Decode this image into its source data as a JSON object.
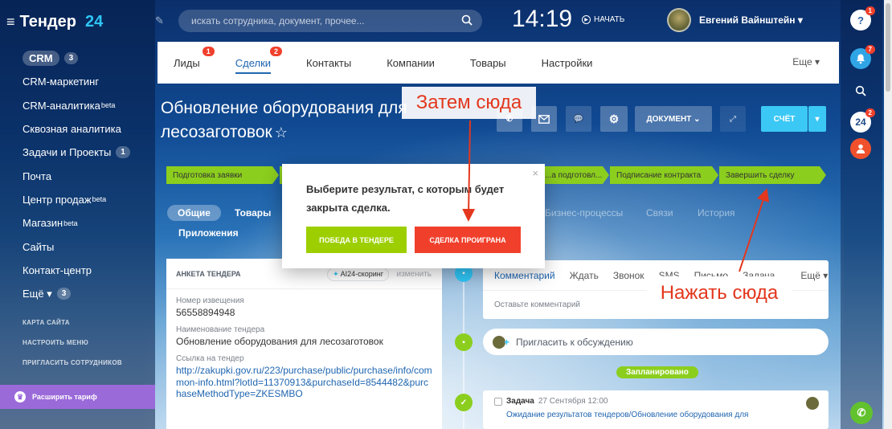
{
  "sidebar": {
    "logo_text": "Тендер",
    "logo_num": "24",
    "crm_label": "CRM",
    "crm_count": "3",
    "items": [
      {
        "label": "CRM-маркетинг"
      },
      {
        "label": "CRM-аналитика",
        "sup": "beta"
      },
      {
        "label": "Сквозная аналитика"
      },
      {
        "label": "Задачи и Проекты",
        "count": "1"
      },
      {
        "label": "Почта"
      },
      {
        "label": "Центр продаж",
        "sup": "beta"
      },
      {
        "label": "Магазин",
        "sup": "beta"
      },
      {
        "label": "Сайты"
      },
      {
        "label": "Контакт-центр"
      },
      {
        "label": "Ещё ▾",
        "count": "3"
      }
    ],
    "sitemap": "Карта сайта",
    "setup_menu": "Настроить меню",
    "invite_staff": "Пригласить сотрудников",
    "upgrade": "Расширить тариф"
  },
  "header": {
    "search_placeholder": "искать сотрудника, документ, прочее...",
    "time": "14:19",
    "start": "НАЧАТЬ",
    "user_name": "Евгений Вайнштейн ▾"
  },
  "rightbar": {
    "help_badge": "1",
    "notify_badge": "7",
    "b24": "24",
    "b24_badge": "2"
  },
  "crm_tabs": {
    "tabs": [
      {
        "label": "Лиды",
        "badge": "1"
      },
      {
        "label": "Сделки",
        "badge": "2"
      },
      {
        "label": "Контакты"
      },
      {
        "label": "Компании"
      },
      {
        "label": "Товары"
      },
      {
        "label": "Настройки"
      }
    ],
    "more": "Еще ▾"
  },
  "deal": {
    "title_line1": "Обновление оборудования для",
    "title_line2": "лесозаготовок",
    "document_btn": "ДОКУМЕНТ ⌄",
    "invoice_btn": "СЧЁТ"
  },
  "stages": [
    "Подготовка заявки",
    "...а подготовл...",
    "Подписание контракта",
    "Завершить сделку"
  ],
  "subtabs": {
    "general": "Общие",
    "products": "Товары",
    "apps": "Приложения",
    "bp": "Бизнес-процессы",
    "links": "Связи",
    "history": "История"
  },
  "popup": {
    "text": "Выберите результат, с которым будет закрыта сделка.",
    "win": "ПОБЕДА В ТЕНДЕРЕ",
    "lose": "СДЕЛКА ПРОИГРАНА"
  },
  "card": {
    "header": "АНКЕТА ТЕНДЕРА",
    "ai": "AI24-скоринг",
    "edit": "изменить",
    "notice_label": "Номер извещения",
    "notice_value": "56558894948",
    "name_label": "Наименование тендера",
    "name_value": "Обновление оборудования для лесозаготовок",
    "link_label": "Ссылка на тендер",
    "link_value": "http://zakupki.gov.ru/223/purchase/public/purchase/info/common-info.html?lotId=11370913&purchaseId=8544482&purchaseMethodType=ZKESMBO"
  },
  "feed": {
    "tabs": [
      "Комментарий",
      "Ждать",
      "Звонок",
      "SMS",
      "Письмо",
      "Задача",
      "Ещё ▾"
    ],
    "comment_placeholder": "Оставьте комментарий",
    "invite": "Пригласить к обсуждению",
    "planned": "Запланировано",
    "task_label": "Задача",
    "task_date": "27 Сентября 12:00",
    "task_link": "Ожидание результатов тендеров/Обновление оборудования для"
  },
  "annotations": {
    "then_here": "Затем сюда",
    "click_here": "Нажать сюда"
  },
  "colors": {
    "accent_blue": "#2066b0",
    "stage_green": "#8cce1e",
    "lose_red": "#f0402c",
    "annotation_red": "#e3371e"
  }
}
